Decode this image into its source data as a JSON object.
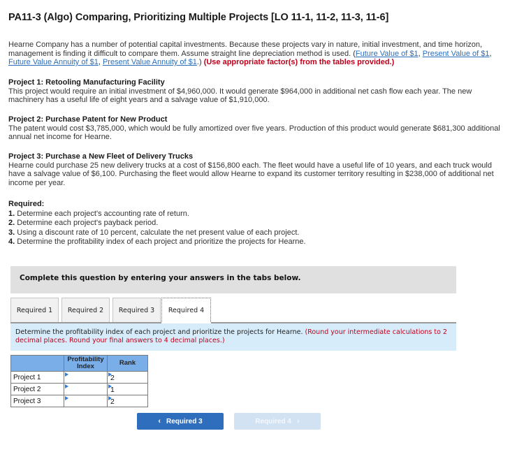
{
  "title": "PA11-3 (Algo) Comparing, Prioritizing Multiple Projects [LO 11-1, 11-2, 11-3, 11-6]",
  "intro": {
    "text_1": "Hearne Company has a number of potential capital investments. Because these projects vary in nature, initial investment, and time horizon, management is finding it difficult to compare them. Assume straight line depreciation method is used. (",
    "links": [
      "Future Value of $1",
      "Present Value of $1",
      "Future Value Annuity of $1",
      "Present Value Annuity of $1"
    ],
    "sep": ", ",
    "close": ".) ",
    "emphasis": "(Use appropriate factor(s) from the tables provided.)"
  },
  "projects": [
    {
      "heading": "Project 1: Retooling Manufacturing Facility",
      "body": "This project would require an initial investment of $4,960,000. It would generate $964,000 in additional net cash flow each year. The new machinery has a useful life of eight years and a salvage value of $1,910,000."
    },
    {
      "heading": "Project 2: Purchase Patent for New Product",
      "body": "The patent would cost $3,785,000, which would be fully amortized over five years. Production of this product would generate $681,300 additional annual net income for Hearne."
    },
    {
      "heading": "Project 3: Purchase a New Fleet of Delivery Trucks",
      "body": "Hearne could purchase 25 new delivery trucks at a cost of $156,800 each. The fleet would have a useful life of 10 years, and each truck would have a salvage value of $6,100. Purchasing the fleet would allow Hearne to expand its customer territory resulting in $238,000 of additional net income per year."
    }
  ],
  "required": {
    "heading": "Required:",
    "items": [
      {
        "num": "1.",
        "text": " Determine each project's accounting rate of return."
      },
      {
        "num": "2.",
        "text": " Determine each project's payback period."
      },
      {
        "num": "3.",
        "text": " Using a discount rate of 10 percent, calculate the net present value of each project."
      },
      {
        "num": "4.",
        "text": " Determine the profitability index of each project and prioritize the projects for Hearne."
      }
    ]
  },
  "instruction": "Complete this question by entering your answers in the tabs below.",
  "tabs": [
    {
      "label": "Required 1",
      "active": false
    },
    {
      "label": "Required 2",
      "active": false
    },
    {
      "label": "Required 3",
      "active": false
    },
    {
      "label": "Required 4",
      "active": true
    }
  ],
  "question": {
    "text": "Determine the profitability index of each project and prioritize the projects for Hearne. ",
    "note": "(Round your intermediate calculations to 2 decimal places. Round your final answers to 4 decimal places.)"
  },
  "table": {
    "headers": [
      "",
      "Profitability Index",
      "Rank"
    ],
    "rows": [
      {
        "label": "Project 1",
        "pi": "",
        "rank": "2"
      },
      {
        "label": "Project 2",
        "pi": "",
        "rank": "1"
      },
      {
        "label": "Project 3",
        "pi": "",
        "rank": "2"
      }
    ]
  },
  "nav": {
    "prev_label": "Required 3",
    "next_label": "Required 4",
    "prev_icon": "chevron-left-icon",
    "next_icon": "chevron-right-icon"
  },
  "colors": {
    "link": "#2a6ebb",
    "emphasis_red": "#c0001a",
    "header_blue": "#7aaee8",
    "question_bg": "#d7ecfa",
    "prev_button": "#2e6ebd",
    "next_button_disabled": "#d3e2f2"
  }
}
